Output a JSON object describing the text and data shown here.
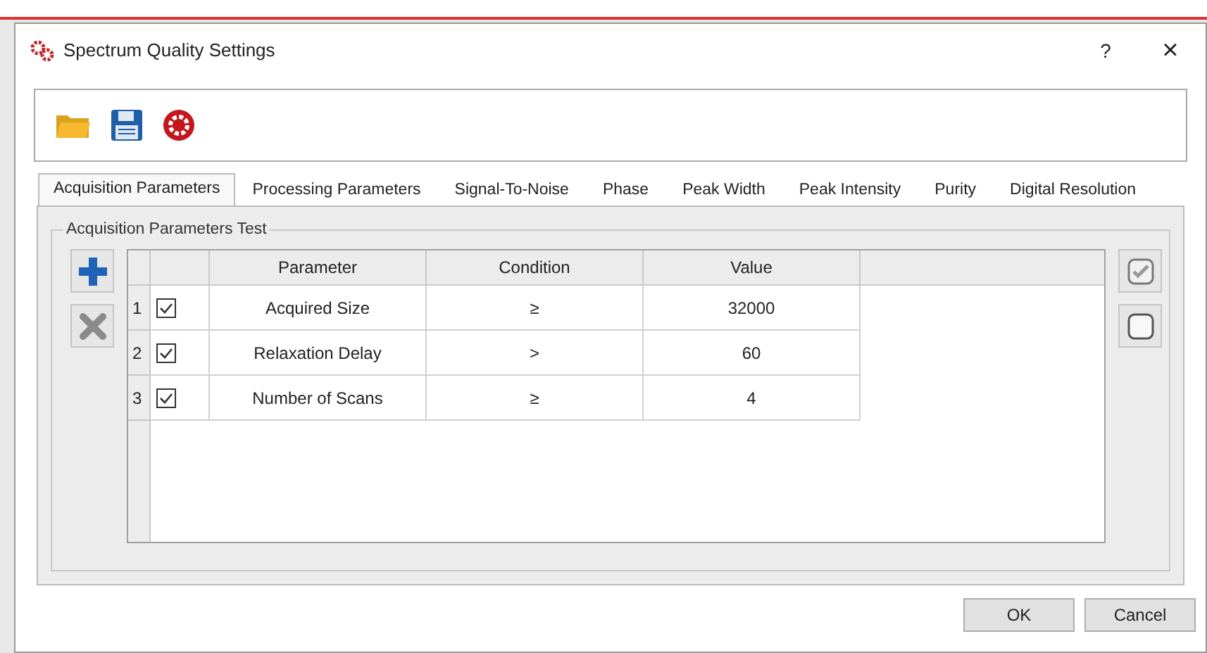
{
  "window": {
    "title": "Spectrum Quality Settings",
    "help_button": "?",
    "close_button": "×"
  },
  "tabs": [
    {
      "label": "Acquisition Parameters",
      "selected": true
    },
    {
      "label": "Processing Parameters",
      "selected": false
    },
    {
      "label": "Signal-To-Noise",
      "selected": false
    },
    {
      "label": "Phase",
      "selected": false
    },
    {
      "label": "Peak Width",
      "selected": false
    },
    {
      "label": "Peak Intensity",
      "selected": false
    },
    {
      "label": "Purity",
      "selected": false
    },
    {
      "label": "Digital Resolution",
      "selected": false
    }
  ],
  "group": {
    "title": "Acquisition Parameters Test"
  },
  "table": {
    "columns": [
      "Parameter",
      "Condition",
      "Value"
    ],
    "rows": [
      {
        "number": "1",
        "checked": true,
        "parameter": "Acquired Size",
        "condition": "≥",
        "value": "32000"
      },
      {
        "number": "2",
        "checked": true,
        "parameter": "Relaxation Delay",
        "condition": ">",
        "value": "60"
      },
      {
        "number": "3",
        "checked": true,
        "parameter": "Number of Scans",
        "condition": "≥",
        "value": "4"
      }
    ]
  },
  "buttons": [
    "OK",
    "Cancel"
  ]
}
